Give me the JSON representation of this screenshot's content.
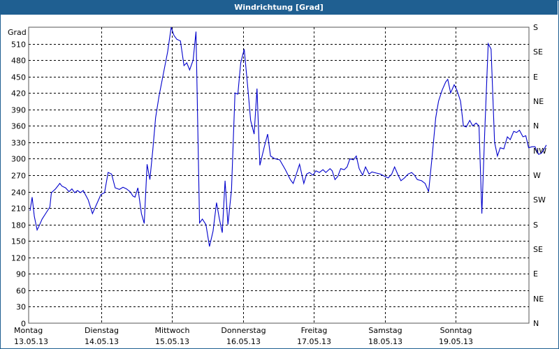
{
  "window": {
    "title": "Windrichtung [Grad]"
  },
  "colors": {
    "titlebar": "#1f5f91",
    "line": "#0000cc",
    "grid": "#000000",
    "axis": "#555555"
  },
  "chart_data": {
    "type": "line",
    "title": "Windrichtung [Grad]",
    "ylabel": "Grad",
    "ylim": [
      0,
      540
    ],
    "yticks": [
      0,
      30,
      60,
      90,
      120,
      150,
      180,
      210,
      240,
      270,
      300,
      330,
      360,
      390,
      420,
      450,
      480,
      510
    ],
    "right_axis": {
      "labels": [
        "N",
        "NE",
        "E",
        "SE",
        "S",
        "SW",
        "W",
        "NW",
        "N",
        "NE",
        "E",
        "SE",
        "S"
      ],
      "values": [
        0,
        45,
        90,
        135,
        180,
        225,
        270,
        315,
        360,
        405,
        450,
        495,
        540
      ]
    },
    "x_days": [
      {
        "day": "Montag",
        "date": "13.05.13"
      },
      {
        "day": "Dienstag",
        "date": "14.05.13"
      },
      {
        "day": "Mittwoch",
        "date": "15.05.13"
      },
      {
        "day": "Donnerstag",
        "date": "16.05.13"
      },
      {
        "day": "Freitag",
        "date": "17.05.13"
      },
      {
        "day": "Samstag",
        "date": "18.05.13"
      },
      {
        "day": "Sonntag",
        "date": "19.05.13"
      }
    ],
    "grid": true,
    "series": [
      {
        "points": [
          [
            0.0,
            205
          ],
          [
            0.03,
            230
          ],
          [
            0.06,
            195
          ],
          [
            0.1,
            170
          ],
          [
            0.13,
            178
          ],
          [
            0.17,
            190
          ],
          [
            0.22,
            200
          ],
          [
            0.28,
            212
          ],
          [
            0.3,
            238
          ],
          [
            0.36,
            245
          ],
          [
            0.42,
            255
          ],
          [
            0.45,
            250
          ],
          [
            0.5,
            247
          ],
          [
            0.55,
            240
          ],
          [
            0.59,
            245
          ],
          [
            0.63,
            238
          ],
          [
            0.67,
            242
          ],
          [
            0.71,
            238
          ],
          [
            0.75,
            242
          ],
          [
            0.82,
            225
          ],
          [
            0.88,
            200
          ],
          [
            1.0,
            235
          ],
          [
            1.05,
            238
          ],
          [
            1.1,
            275
          ],
          [
            1.15,
            272
          ],
          [
            1.2,
            247
          ],
          [
            1.26,
            244
          ],
          [
            1.31,
            248
          ],
          [
            1.36,
            245
          ],
          [
            1.41,
            240
          ],
          [
            1.45,
            232
          ],
          [
            1.48,
            230
          ],
          [
            1.52,
            247
          ],
          [
            1.57,
            200
          ],
          [
            1.61,
            182
          ],
          [
            1.65,
            290
          ],
          [
            1.69,
            262
          ],
          [
            1.73,
            315
          ],
          [
            1.77,
            375
          ],
          [
            1.82,
            415
          ],
          [
            1.88,
            455
          ],
          [
            1.94,
            495
          ],
          [
            1.99,
            540
          ],
          [
            2.03,
            525
          ],
          [
            2.07,
            518
          ],
          [
            2.12,
            515
          ],
          [
            2.17,
            470
          ],
          [
            2.21,
            475
          ],
          [
            2.25,
            462
          ],
          [
            2.3,
            480
          ],
          [
            2.34,
            532
          ],
          [
            2.39,
            183
          ],
          [
            2.43,
            190
          ],
          [
            2.48,
            180
          ],
          [
            2.53,
            140
          ],
          [
            2.58,
            168
          ],
          [
            2.63,
            220
          ],
          [
            2.67,
            190
          ],
          [
            2.71,
            165
          ],
          [
            2.75,
            260
          ],
          [
            2.79,
            180
          ],
          [
            2.84,
            243
          ],
          [
            2.89,
            420
          ],
          [
            2.93,
            418
          ],
          [
            2.97,
            475
          ],
          [
            3.02,
            500
          ],
          [
            3.07,
            430
          ],
          [
            3.11,
            370
          ],
          [
            3.16,
            345
          ],
          [
            3.2,
            428
          ],
          [
            3.24,
            288
          ],
          [
            3.3,
            320
          ],
          [
            3.35,
            345
          ],
          [
            3.39,
            305
          ],
          [
            3.45,
            300
          ],
          [
            3.52,
            298
          ],
          [
            3.6,
            280
          ],
          [
            3.67,
            262
          ],
          [
            3.71,
            255
          ],
          [
            3.75,
            270
          ],
          [
            3.8,
            290
          ],
          [
            3.86,
            255
          ],
          [
            3.9,
            272
          ],
          [
            3.94,
            275
          ],
          [
            3.99,
            270
          ],
          [
            4.03,
            278
          ],
          [
            4.08,
            275
          ],
          [
            4.13,
            280
          ],
          [
            4.17,
            275
          ],
          [
            4.23,
            282
          ],
          [
            4.26,
            278
          ],
          [
            4.3,
            262
          ],
          [
            4.34,
            268
          ],
          [
            4.38,
            282
          ],
          [
            4.43,
            280
          ],
          [
            4.47,
            285
          ],
          [
            4.51,
            300
          ],
          [
            4.56,
            298
          ],
          [
            4.6,
            305
          ],
          [
            4.64,
            282
          ],
          [
            4.69,
            270
          ],
          [
            4.73,
            285
          ],
          [
            4.78,
            272
          ],
          [
            4.82,
            276
          ],
          [
            4.88,
            274
          ],
          [
            4.94,
            272
          ],
          [
            5.0,
            268
          ],
          [
            5.05,
            265
          ],
          [
            5.1,
            272
          ],
          [
            5.14,
            285
          ],
          [
            5.19,
            270
          ],
          [
            5.23,
            260
          ],
          [
            5.28,
            265
          ],
          [
            5.33,
            272
          ],
          [
            5.38,
            275
          ],
          [
            5.42,
            270
          ],
          [
            5.46,
            262
          ],
          [
            5.52,
            260
          ],
          [
            5.57,
            255
          ],
          [
            5.62,
            240
          ],
          [
            5.67,
            305
          ],
          [
            5.72,
            375
          ],
          [
            5.76,
            405
          ],
          [
            5.81,
            425
          ],
          [
            5.86,
            440
          ],
          [
            5.89,
            445
          ],
          [
            5.93,
            420
          ],
          [
            5.98,
            435
          ],
          [
            6.02,
            425
          ],
          [
            6.07,
            405
          ],
          [
            6.11,
            360
          ],
          [
            6.15,
            358
          ],
          [
            6.2,
            370
          ],
          [
            6.24,
            360
          ],
          [
            6.29,
            365
          ],
          [
            6.33,
            360
          ],
          [
            6.37,
            200
          ],
          [
            6.41,
            345
          ],
          [
            6.46,
            510
          ],
          [
            6.5,
            500
          ],
          [
            6.55,
            330
          ],
          [
            6.59,
            305
          ],
          [
            6.63,
            320
          ],
          [
            6.68,
            318
          ],
          [
            6.73,
            340
          ],
          [
            6.77,
            335
          ],
          [
            6.82,
            350
          ],
          [
            6.86,
            348
          ],
          [
            6.9,
            352
          ],
          [
            6.95,
            340
          ],
          [
            6.99,
            342
          ],
          [
            7.03,
            320
          ],
          [
            7.08,
            322
          ],
          [
            7.12,
            322
          ],
          [
            7.17,
            308
          ],
          [
            7.21,
            310
          ],
          [
            7.25,
            318
          ],
          [
            7.28,
            325
          ]
        ]
      }
    ]
  }
}
